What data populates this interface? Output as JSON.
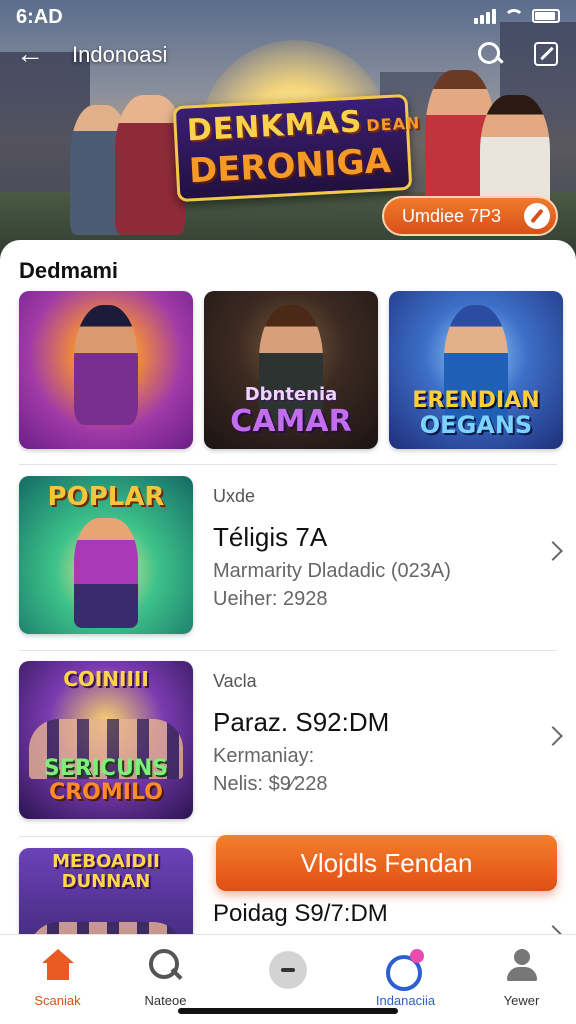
{
  "status_bar": {
    "time": "6:AD"
  },
  "header": {
    "title": "Indonoasi",
    "hero_title_line1": "DENKMAS",
    "hero_title_line1_small": "DEAN",
    "hero_title_line2": "DERONIGA",
    "hero_button_label": "Umdiee 7P3"
  },
  "featured": {
    "title": "Dedmami",
    "cards": [
      {
        "logo_line1": "",
        "logo_line2": ""
      },
      {
        "logo_line1": "Dbntenia",
        "logo_line2": "CAMAR"
      },
      {
        "logo_line1": "ERENDIAN",
        "logo_line2": "OEGANS"
      }
    ]
  },
  "list": {
    "items": [
      {
        "thumb_logo": "POPLAR",
        "category": "Uxde",
        "name": "Téligis 7A",
        "subtitle": "Marmarity Dladadic (023A)",
        "value": "Ueiher: 2928"
      },
      {
        "thumb_logo_top": "COINIIII",
        "thumb_logo_bottom1": "SERICUNS",
        "thumb_logo_bottom2": "CROMILO",
        "category": "Vacla",
        "name": "Paraz. S92:DM",
        "subtitle": "Kermaniay:",
        "value": "Nelis: $9⁄228"
      },
      {
        "thumb_logo": "MEBOAIDII",
        "thumb_logo2": "DUNNAN",
        "category": "",
        "name": "Poidag S9/7:DM",
        "subtitle": "",
        "value": ""
      }
    ]
  },
  "cta": {
    "label": "Vlojdls Fendan"
  },
  "bottom_nav": {
    "items": [
      {
        "label": "Scaniak",
        "icon": "home-icon"
      },
      {
        "label": "Nateoe",
        "icon": "search-icon"
      },
      {
        "label": "",
        "icon": "more-icon"
      },
      {
        "label": "Indanaciia",
        "icon": "chat-icon"
      },
      {
        "label": "Yewer",
        "icon": "profile-icon"
      }
    ]
  },
  "colors": {
    "accent": "#e85a1c",
    "accent_blue": "#2d5fd0",
    "badge_pink": "#e84cb0"
  }
}
